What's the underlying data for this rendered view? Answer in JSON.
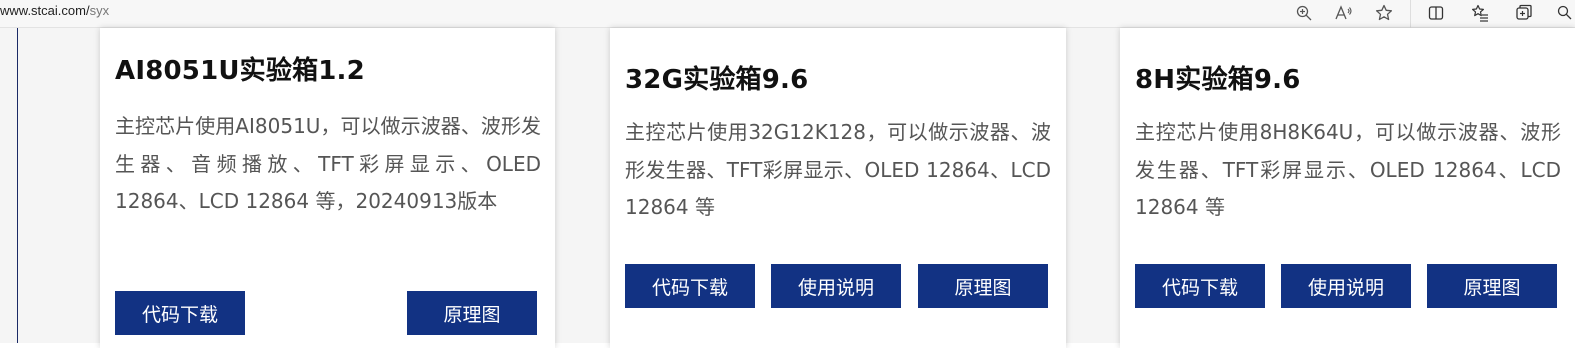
{
  "browser": {
    "url_host": "www.stcai.com/",
    "url_path": "syx",
    "icons": [
      "zoom-icon",
      "read-aloud-icon",
      "favorite-star-icon",
      "split-screen-icon",
      "favorites-list-icon",
      "collections-icon",
      "extensions-icon"
    ]
  },
  "colors": {
    "button_bg": "#123283",
    "button_text": "#ffffff",
    "title_text": "#111111",
    "desc_text": "#555555"
  },
  "cards": [
    {
      "title": "AI8051U实验箱1.2",
      "description": "主控芯片使用AI8051U，可以做示波器、波形发生器、音频播放、TFT彩屏显示、OLED 12864、LCD 12864 等，20240913版本",
      "buttons": [
        "代码下载",
        "原理图"
      ]
    },
    {
      "title": "32G实验箱9.6",
      "description": "主控芯片使用32G12K128，可以做示波器、波形发生器、TFT彩屏显示、OLED 12864、LCD 12864 等",
      "buttons": [
        "代码下载",
        "使用说明",
        "原理图"
      ]
    },
    {
      "title": "8H实验箱9.6",
      "description": "主控芯片使用8H8K64U，可以做示波器、波形发生器、TFT彩屏显示、OLED 12864、LCD 12864 等",
      "buttons": [
        "代码下载",
        "使用说明",
        "原理图"
      ]
    }
  ]
}
